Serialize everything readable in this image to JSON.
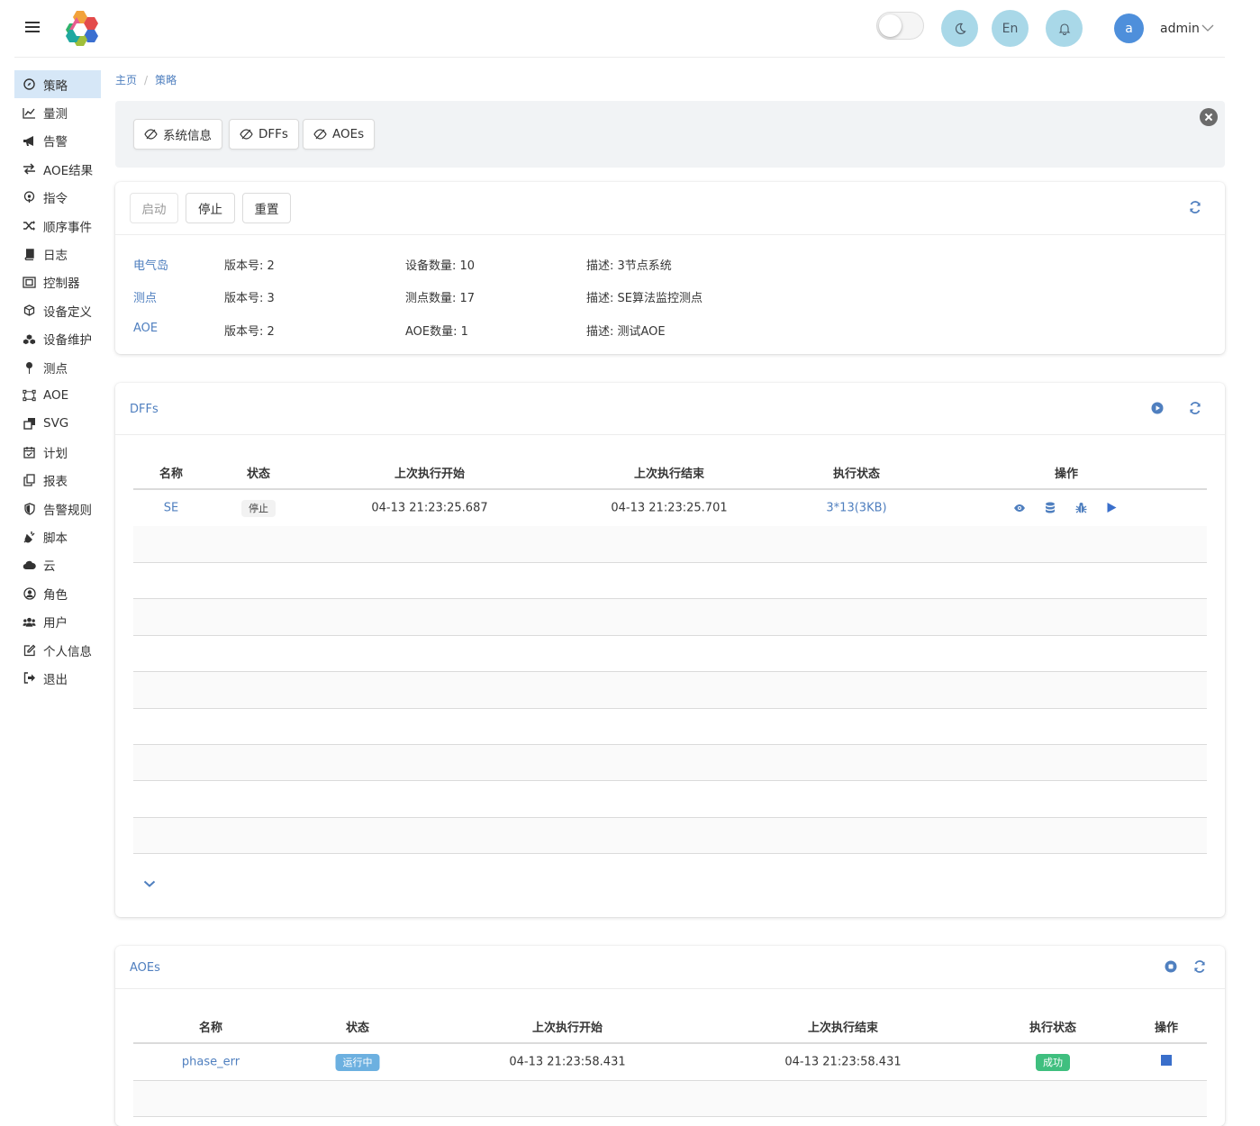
{
  "header": {
    "lang_label": "En",
    "avatar_letter": "a",
    "user_name": "admin"
  },
  "sidebar": {
    "items": [
      {
        "label": "策略",
        "icon": "compass-icon",
        "active": true
      },
      {
        "label": "量测",
        "icon": "line-chart-icon"
      },
      {
        "label": "告警",
        "icon": "bullhorn-icon"
      },
      {
        "label": "AOE结果",
        "icon": "exchange-icon"
      },
      {
        "label": "指令",
        "icon": "podcast-icon"
      },
      {
        "label": "顺序事件",
        "icon": "shuffle-icon"
      },
      {
        "label": "日志",
        "icon": "book-icon"
      },
      {
        "label": "控制器",
        "icon": "object-group-icon"
      },
      {
        "label": "设备定义",
        "icon": "cube-icon"
      },
      {
        "label": "设备维护",
        "icon": "cubes-icon"
      },
      {
        "label": "测点",
        "icon": "map-pin-icon"
      },
      {
        "label": "AOE",
        "icon": "bezier-icon"
      },
      {
        "label": "SVG",
        "icon": "clone-icon"
      },
      {
        "label": "计划",
        "icon": "calendar-check-icon"
      },
      {
        "label": "报表",
        "icon": "copy-icon"
      },
      {
        "label": "告警规则",
        "icon": "shield-icon"
      },
      {
        "label": "脚本",
        "icon": "plug-icon"
      },
      {
        "label": "云",
        "icon": "cloud-icon"
      },
      {
        "label": "角色",
        "icon": "user-circle-icon"
      },
      {
        "label": "用户",
        "icon": "users-icon"
      },
      {
        "label": "个人信息",
        "icon": "edit-icon"
      },
      {
        "label": "退出",
        "icon": "sign-out-icon"
      }
    ]
  },
  "breadcrumb": {
    "home": "主页",
    "current": "策略"
  },
  "notice": {
    "tags": [
      "系统信息",
      "DFFs",
      "AOEs"
    ]
  },
  "control": {
    "start_label": "启动",
    "stop_label": "停止",
    "reset_label": "重置",
    "rows": [
      {
        "name": "电气岛",
        "version": "版本号: 2",
        "count": "设备数量: 10",
        "desc": "描述: 3节点系统"
      },
      {
        "name": "测点",
        "version": "版本号: 3",
        "count": "测点数量: 17",
        "desc": "描述: SE算法监控测点"
      },
      {
        "name": "AOE",
        "version": "版本号: 2",
        "count": "AOE数量: 1",
        "desc": "描述: 测试AOE"
      }
    ]
  },
  "dffs": {
    "title": "DFFs",
    "columns": [
      "名称",
      "状态",
      "上次执行开始",
      "上次执行结束",
      "执行状态",
      "操作"
    ],
    "rows": [
      {
        "name": "SE",
        "status": "停止",
        "start": "04-13 21:23:25.687",
        "end": "04-13 21:23:25.701",
        "exec": "3*13(3KB)"
      }
    ]
  },
  "aoes": {
    "title": "AOEs",
    "columns": [
      "名称",
      "状态",
      "上次执行开始",
      "上次执行结束",
      "执行状态",
      "操作"
    ],
    "rows": [
      {
        "name": "phase_err",
        "status": "运行中",
        "start": "04-13 21:23:58.431",
        "end": "04-13 21:23:58.431",
        "exec": "成功"
      }
    ]
  },
  "colors": {
    "accent": "#4f7fbf",
    "active_bg": "#d6e7f7",
    "success": "#3fbf7f",
    "info": "#6cb0e0"
  }
}
